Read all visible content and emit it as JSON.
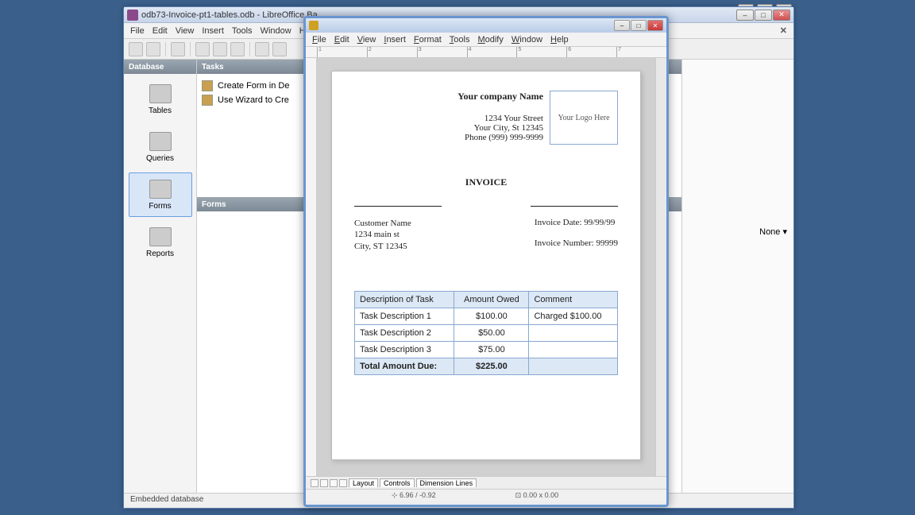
{
  "base": {
    "title": "odb73-Invoice-pt1-tables.odb - LibreOffice Ba",
    "menu": [
      "File",
      "Edit",
      "View",
      "Insert",
      "Tools",
      "Window",
      "He"
    ],
    "database_label": "Database",
    "tasks_label": "Tasks",
    "forms_label": "Forms",
    "db_items": [
      {
        "label": "Tables"
      },
      {
        "label": "Queries"
      },
      {
        "label": "Forms"
      },
      {
        "label": "Reports"
      }
    ],
    "tasks": [
      {
        "label": "Create Form in De"
      },
      {
        "label": "Use Wizard to Cre"
      }
    ],
    "right_none": "None",
    "status": "Embedded database"
  },
  "writer": {
    "menu": [
      "File",
      "Edit",
      "View",
      "Insert",
      "Format",
      "Tools",
      "Modify",
      "Window",
      "Help"
    ],
    "ruler": [
      "1",
      "2",
      "3",
      "4",
      "5",
      "6",
      "7"
    ],
    "tabs": [
      "Layout",
      "Controls",
      "Dimension Lines"
    ],
    "status_coord": "6.96 / -0.92",
    "status_size": "0.00 x 0.00"
  },
  "invoice": {
    "company_name": "Your company Name",
    "street": "1234 Your Street",
    "city": "Your City, St 12345",
    "phone": "Phone (999) 999-9999",
    "logo": "Your Logo Here",
    "title": "INVOICE",
    "customer_name": "Customer Name",
    "customer_street": "1234 main st",
    "customer_city": "City, ST 12345",
    "date_label": "Invoice Date:",
    "date_value": "99/99/99",
    "number_label": "Invoice Number:",
    "number_value": "99999",
    "table_headers": [
      "Description of Task",
      "Amount Owed",
      "Comment"
    ],
    "rows": [
      {
        "desc": "Task Description 1",
        "amount": "$100.00",
        "comment": "Charged $100.00"
      },
      {
        "desc": "Task Description 2",
        "amount": "$50.00",
        "comment": ""
      },
      {
        "desc": "Task Description 3",
        "amount": "$75.00",
        "comment": ""
      }
    ],
    "total_label": "Total Amount Due:",
    "total_value": "$225.00"
  }
}
